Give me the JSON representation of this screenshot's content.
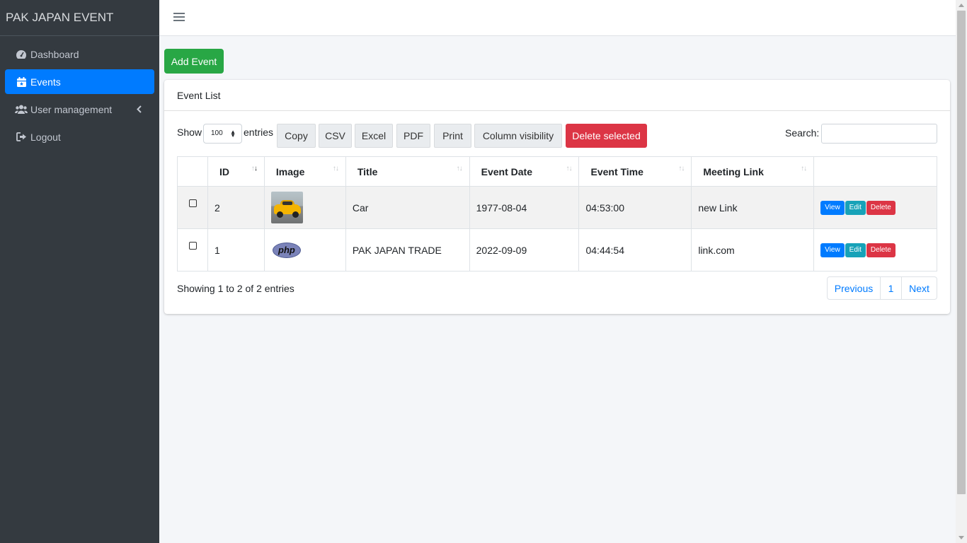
{
  "app": {
    "brand": "PAK JAPAN EVENT"
  },
  "sidebar": {
    "items": [
      {
        "label": "Dashboard",
        "icon": "tachometer-icon",
        "active": false
      },
      {
        "label": "Events",
        "icon": "calendar-icon",
        "active": true
      },
      {
        "label": "User management",
        "icon": "users-icon",
        "active": false
      },
      {
        "label": "Logout",
        "icon": "sign-out-icon",
        "active": false
      }
    ]
  },
  "toolbar": {
    "add_event_label": "Add Event"
  },
  "card": {
    "title": "Event List"
  },
  "controls": {
    "show_label": "Show",
    "entries_label": "entries",
    "page_length": "100",
    "buttons": [
      "Copy",
      "CSV",
      "Excel",
      "PDF",
      "Print",
      "Column visibility"
    ],
    "delete_selected": "Delete selected",
    "search_label": "Search:",
    "search_value": ""
  },
  "table": {
    "headers": [
      "ID",
      "Image",
      "Title",
      "Event Date",
      "Event Time",
      "Meeting Link"
    ],
    "rows": [
      {
        "id": "2",
        "image": "car-image",
        "title": "Car",
        "date": "1977-08-04",
        "time": "04:53:00",
        "link": "new Link"
      },
      {
        "id": "1",
        "image": "php-logo",
        "title": "PAK JAPAN TRADE",
        "date": "2022-09-09",
        "time": "04:44:54",
        "link": "link.com"
      }
    ],
    "actions": {
      "view": "View",
      "edit": "Edit",
      "delete": "Delete"
    },
    "php_text": "php"
  },
  "footer": {
    "info": "Showing 1 to 2 of 2 entries",
    "prev": "Previous",
    "page": "1",
    "next": "Next"
  },
  "colors": {
    "sidebar": "#343a40",
    "primary": "#007bff",
    "success": "#28a745",
    "danger": "#dc3545",
    "info": "#17a2b8"
  }
}
